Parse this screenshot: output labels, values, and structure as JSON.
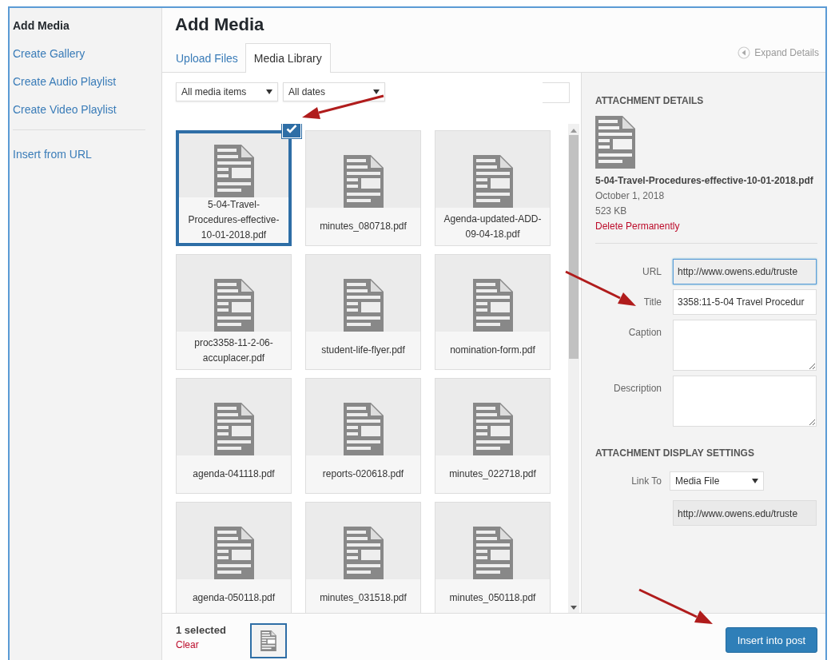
{
  "sidebar": {
    "title": "Add Media",
    "actions": [
      "Create Gallery",
      "Create Audio Playlist",
      "Create Video Playlist"
    ],
    "extra": [
      "Insert from URL"
    ]
  },
  "header": {
    "title": "Add Media",
    "expand_details": "Expand Details"
  },
  "tabs": [
    {
      "label": "Upload Files",
      "selected": false
    },
    {
      "label": "Media Library",
      "selected": true
    }
  ],
  "filters": [
    {
      "value": "All media items"
    },
    {
      "value": "All dates"
    }
  ],
  "items": [
    {
      "name": "5-04-Travel-Procedures-effective-10-01-2018.pdf",
      "selected": true
    },
    {
      "name": "minutes_080718.pdf",
      "selected": false
    },
    {
      "name": "Agenda-updated-ADD-09-04-18.pdf",
      "selected": false
    },
    {
      "name": "proc3358-11-2-06-accuplacer.pdf",
      "selected": false
    },
    {
      "name": "student-life-flyer.pdf",
      "selected": false
    },
    {
      "name": "nomination-form.pdf",
      "selected": false
    },
    {
      "name": "agenda-041118.pdf",
      "selected": false
    },
    {
      "name": "reports-020618.pdf",
      "selected": false
    },
    {
      "name": "minutes_022718.pdf",
      "selected": false
    },
    {
      "name": "agenda-050118.pdf",
      "selected": false
    },
    {
      "name": "minutes_031518.pdf",
      "selected": false
    },
    {
      "name": "minutes_050118.pdf",
      "selected": false
    }
  ],
  "details": {
    "heading": "ATTACHMENT DETAILS",
    "filename": "5-04-Travel-Procedures-effective-10-01-2018.pdf",
    "date": "October 1, 2018",
    "size": "523 KB",
    "delete": "Delete Permanently",
    "fields": [
      {
        "label": "URL",
        "value": "http://www.owens.edu/truste",
        "kind": "input",
        "focused": true
      },
      {
        "label": "Title",
        "value": "3358:11-5-04 Travel Procedur",
        "kind": "input",
        "focused": false
      },
      {
        "label": "Caption",
        "kind": "textarea",
        "focused": false
      },
      {
        "label": "Description",
        "kind": "textarea",
        "focused": false
      }
    ],
    "display_heading": "ATTACHMENT DISPLAY SETTINGS",
    "link_to": {
      "label": "Link To",
      "value": "Media File"
    },
    "link_url": "http://www.owens.edu/truste"
  },
  "footer": {
    "count": "1 selected",
    "clear": "Clear",
    "button": "Insert into post"
  }
}
